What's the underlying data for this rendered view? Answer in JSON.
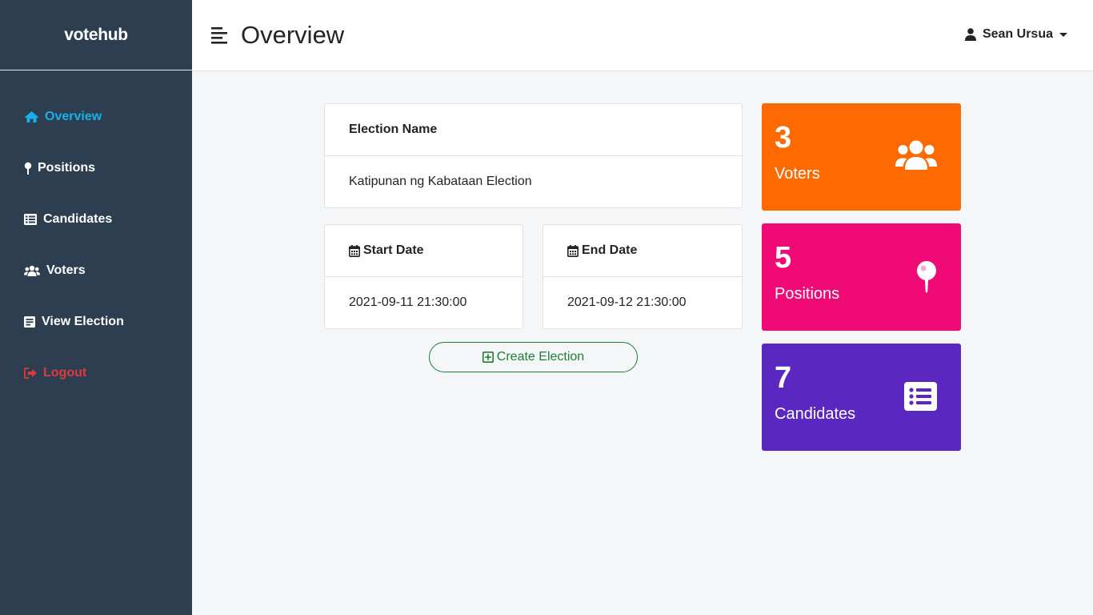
{
  "brand": "votehub",
  "sidebar": {
    "items": [
      {
        "label": "Overview",
        "icon": "home-icon"
      },
      {
        "label": "Positions",
        "icon": "pin-icon"
      },
      {
        "label": "Candidates",
        "icon": "list-icon"
      },
      {
        "label": "Voters",
        "icon": "users-icon"
      },
      {
        "label": "View Election",
        "icon": "document-icon"
      },
      {
        "label": "Logout",
        "icon": "sign-out-icon"
      }
    ],
    "active": "Overview"
  },
  "header": {
    "title": "Overview",
    "user_name": "Sean Ursua"
  },
  "election": {
    "name_label": "Election Name",
    "name_value": "Katipunan ng Kabataan Election",
    "start_label": "Start Date",
    "start_value": "2021-09-11 21:30:00",
    "end_label": "End Date",
    "end_value": "2021-09-12 21:30:00",
    "create_button": "Create Election"
  },
  "stats": [
    {
      "value": "3",
      "label": "Voters",
      "color": "#fd6a02",
      "icon": "users-icon"
    },
    {
      "value": "5",
      "label": "Positions",
      "color": "#ef0a75",
      "icon": "pin-icon"
    },
    {
      "value": "7",
      "label": "Candidates",
      "color": "#5a28c0",
      "icon": "list-icon"
    }
  ],
  "colors": {
    "sidebar_bg": "#2c3e50",
    "active": "#16b1e8",
    "logout": "#e03a3e",
    "success": "#1e7e34"
  }
}
